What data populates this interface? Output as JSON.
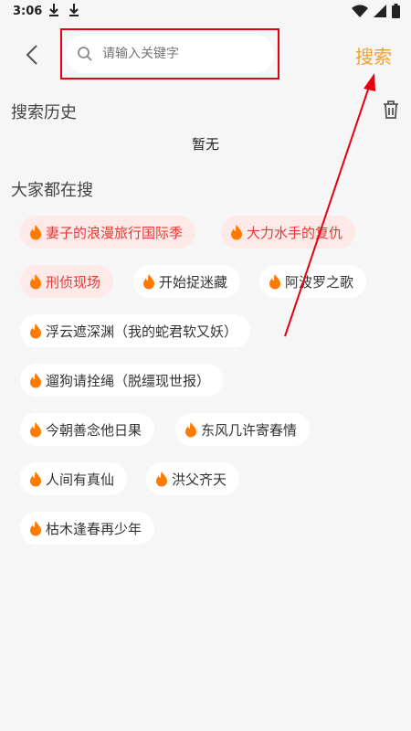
{
  "status_bar": {
    "time": "3:06",
    "icons": [
      "download-icon",
      "download-icon",
      "wifi-icon",
      "signal-icon",
      "battery-icon"
    ]
  },
  "header": {
    "back_icon": "chevron-left-icon",
    "search_placeholder": "请输入关键字",
    "search_button": "搜索"
  },
  "history": {
    "title": "搜索历史",
    "empty_text": "暂无",
    "delete_icon": "trash-icon"
  },
  "popular": {
    "title": "大家都在搜",
    "tags": [
      {
        "label": "妻子的浪漫旅行国际季",
        "hot": true
      },
      {
        "label": "大力水手的复仇",
        "hot": true
      },
      {
        "label": "刑侦现场",
        "hot": true
      },
      {
        "label": "开始捉迷藏",
        "hot": false
      },
      {
        "label": "阿波罗之歌",
        "hot": false
      },
      {
        "label": "浮云遮深渊（我的蛇君软又妖）",
        "hot": false
      },
      {
        "label": "遛狗请拴绳（脱缰现世报）",
        "hot": false
      },
      {
        "label": "今朝善念他日果",
        "hot": false
      },
      {
        "label": "东风几许寄春情",
        "hot": false
      },
      {
        "label": "人间有真仙",
        "hot": false
      },
      {
        "label": "洪父齐天",
        "hot": false
      },
      {
        "label": "枯木逢春再少年",
        "hot": false
      }
    ]
  },
  "colors": {
    "accent": "#f0a030",
    "hot_text": "#e53935",
    "hot_bg": "#fde9e8",
    "annotation": "#e60012"
  }
}
